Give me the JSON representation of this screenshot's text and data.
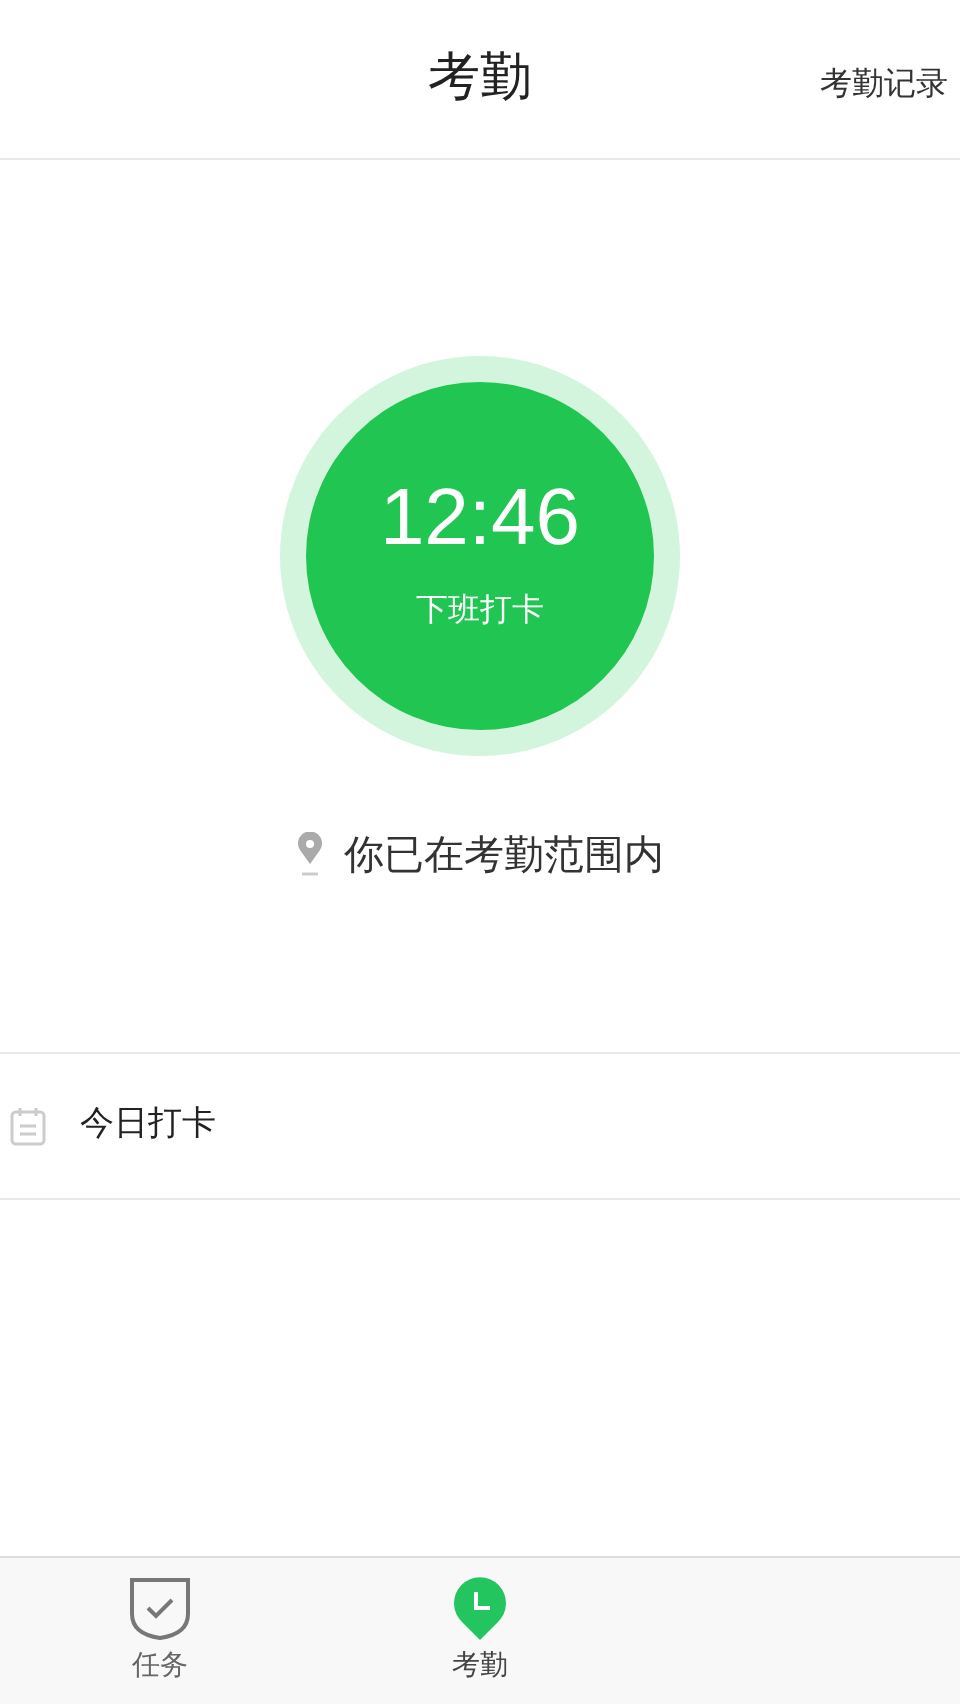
{
  "header": {
    "title": "考勤",
    "action": "考勤记录"
  },
  "clock": {
    "time": "12:46",
    "label": "下班打卡"
  },
  "location": {
    "text": "你已在考勤范围内"
  },
  "today": {
    "label": "今日打卡"
  },
  "tabs": [
    {
      "label": "任务",
      "kind": "task",
      "selected": false
    },
    {
      "label": "考勤",
      "kind": "attendance",
      "selected": true
    }
  ]
}
